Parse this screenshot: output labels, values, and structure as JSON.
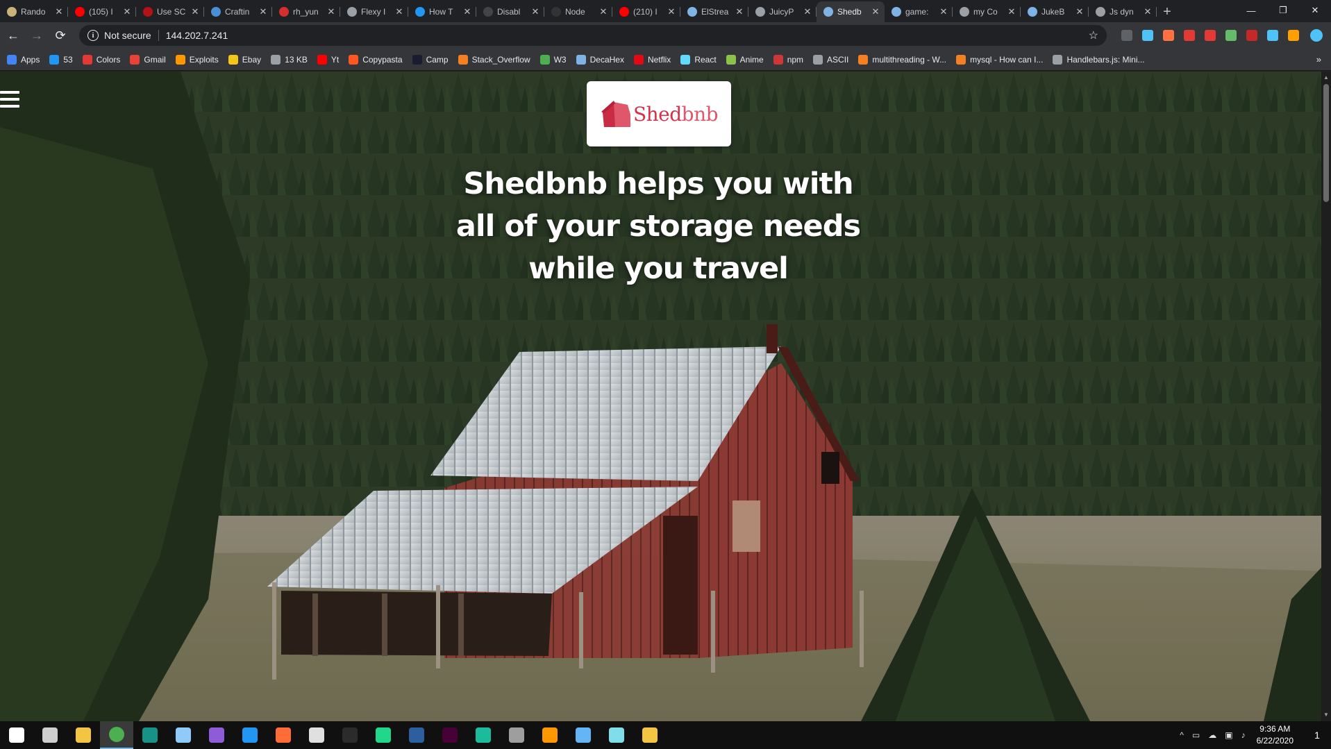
{
  "browser": {
    "tabs": [
      {
        "label": "Rando",
        "color": "#c9b37a",
        "active": false
      },
      {
        "label": "(105) I",
        "color": "#ff0000",
        "active": false
      },
      {
        "label": "Use SC",
        "color": "#b31217",
        "active": false
      },
      {
        "label": "Craftin",
        "color": "#4a90d9",
        "active": false
      },
      {
        "label": "rh_yun",
        "color": "#d32f2f",
        "active": false
      },
      {
        "label": "Flexy I",
        "color": "#9aa0a6",
        "active": false
      },
      {
        "label": "How T",
        "color": "#2196f3",
        "active": false
      },
      {
        "label": "Disabl",
        "color": "#444444",
        "active": false
      },
      {
        "label": "Node",
        "color": "#333333",
        "active": false
      },
      {
        "label": "(210) I",
        "color": "#ff0000",
        "active": false
      },
      {
        "label": "ElStrea",
        "color": "#7fb3e6",
        "active": false
      },
      {
        "label": "JuicyP",
        "color": "#9aa0a6",
        "active": false
      },
      {
        "label": "Shedb",
        "color": "#7fb3e6",
        "active": true
      },
      {
        "label": "game:",
        "color": "#7fb3e6",
        "active": false
      },
      {
        "label": "my Co",
        "color": "#9aa0a6",
        "active": false
      },
      {
        "label": "JukeB",
        "color": "#7fb3e6",
        "active": false
      },
      {
        "label": "Js dyn",
        "color": "#9aa0a6",
        "active": false
      }
    ],
    "new_tab": "+",
    "window_controls": {
      "minimize": "—",
      "restore": "❐",
      "close": "✕"
    },
    "nav": {
      "back": "←",
      "forward": "→",
      "reload": "⟳"
    },
    "address": {
      "security_label": "Not secure",
      "url": "144.202.7.241",
      "bookmark_star": "☆"
    },
    "extension_colors": [
      "#5f6368",
      "#4fc3f7",
      "#ff7043",
      "#e53935",
      "#e53935",
      "#66bb6a",
      "#c62828",
      "#4fc3f7",
      "#ffa000"
    ],
    "bookmarks": [
      {
        "label": "Apps",
        "color": "#4285f4"
      },
      {
        "label": "53",
        "color": "#2196f3"
      },
      {
        "label": "Colors",
        "color": "#e53935"
      },
      {
        "label": "Gmail",
        "color": "#ea4335"
      },
      {
        "label": "Exploits",
        "color": "#ff9800"
      },
      {
        "label": "Ebay",
        "color": "#f5c518"
      },
      {
        "label": "13 KB",
        "color": "#9aa0a6"
      },
      {
        "label": "Yt",
        "color": "#ff0000"
      },
      {
        "label": "Copypasta",
        "color": "#ff5722"
      },
      {
        "label": "Camp",
        "color": "#1b1b32"
      },
      {
        "label": "Stack_Overflow",
        "color": "#f48024"
      },
      {
        "label": "W3",
        "color": "#4caf50"
      },
      {
        "label": "DecaHex",
        "color": "#7fb3e6"
      },
      {
        "label": "Netflix",
        "color": "#e50914"
      },
      {
        "label": "React",
        "color": "#61dafb"
      },
      {
        "label": "Anime",
        "color": "#8bc34a"
      },
      {
        "label": "npm",
        "color": "#cb3837"
      },
      {
        "label": "ASCII",
        "color": "#9aa0a6"
      },
      {
        "label": "multithreading - W...",
        "color": "#f48024"
      },
      {
        "label": "mysql - How can I...",
        "color": "#f48024"
      },
      {
        "label": "Handlebars.js: Mini...",
        "color": "#9aa0a6"
      }
    ],
    "bookmarks_overflow": "»"
  },
  "page": {
    "menu_icon": "hamburger-menu",
    "logo": {
      "word_bold": "Shed",
      "word_light": "bnb",
      "icon": "shed-icon",
      "color": "#d6314b"
    },
    "hero_lines": [
      "Shedbnb helps you with",
      "all of your storage needs",
      "while you travel"
    ]
  },
  "taskbar": {
    "apps": [
      {
        "name": "start",
        "color": "#ffffff"
      },
      {
        "name": "task-view",
        "color": "#cfcfcf"
      },
      {
        "name": "file-explorer",
        "color": "#f4c542"
      },
      {
        "name": "chrome",
        "color": "#4caf50"
      },
      {
        "name": "gitkraken",
        "color": "#179287"
      },
      {
        "name": "documents",
        "color": "#90caf9"
      },
      {
        "name": "visual-studio",
        "color": "#8e5cd9"
      },
      {
        "name": "vscode",
        "color": "#2196f3"
      },
      {
        "name": "postman",
        "color": "#ff6c37"
      },
      {
        "name": "inkscape",
        "color": "#e0e0e0"
      },
      {
        "name": "terminal",
        "color": "#2b2b2b"
      },
      {
        "name": "pycharm",
        "color": "#21d789"
      },
      {
        "name": "powershell",
        "color": "#2d5fa0"
      },
      {
        "name": "adobe-xd",
        "color": "#470137"
      },
      {
        "name": "gitkraken-alt",
        "color": "#1abc9c"
      },
      {
        "name": "davinci",
        "color": "#9e9e9e"
      },
      {
        "name": "sublime",
        "color": "#ff9800"
      },
      {
        "name": "azure-studio",
        "color": "#64b5f6"
      },
      {
        "name": "notepad",
        "color": "#80deea"
      },
      {
        "name": "git",
        "color": "#f4c542"
      }
    ],
    "tray": {
      "chevron": "^",
      "time": "9:36 AM",
      "date": "6/22/2020",
      "notification_count": "1"
    }
  }
}
